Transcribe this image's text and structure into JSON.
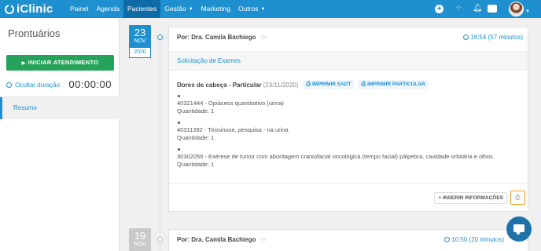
{
  "app": {
    "logo_text": "iClinic",
    "nav": [
      "Painel",
      "Agenda",
      "Pacientes",
      "Gestão",
      "Marketing",
      "Outros"
    ],
    "nav_active": "Pacientes",
    "top_icons": [
      "plus-circle-icon",
      "apps-grid-icon",
      "bell-icon",
      "chat-icon",
      "user-avatar"
    ]
  },
  "sidebar": {
    "title": "Prontuários",
    "start_button": "INICIAR ATENDIMENTO",
    "hide_duration": "Ocultar duração",
    "timer": "00:00:00",
    "items": [
      {
        "label": "Resumo",
        "active": true
      }
    ]
  },
  "timeline": {
    "entries": [
      {
        "day": "23",
        "month": "NOV",
        "year": "2020",
        "author": "Por: Dra. Camila Bachiego",
        "time": "16:54 (57 minutos)",
        "section_title": "Solicitação de Exames",
        "request_title": "Dores de cabeça - Particular",
        "request_date": "(23/11/2020)",
        "buttons": [
          "IMPRIMIR SADT",
          "IMPRIMIR PARTICULAR"
        ],
        "exams": [
          {
            "name": "40321444 - Opiáceos quantitativo (urina)",
            "qty": "Quantidade: 1"
          },
          {
            "name": "40311392 - Tirosinose, pesquisa - na urina",
            "qty": "Quantidade: 1"
          },
          {
            "name": "30302056 - Exérese de tumor com abordagem craniofacial oncológica (tempo facial) pálpebra, cavidade orbitária e olhos",
            "qty": "Quantidade: 1"
          }
        ],
        "insert_button": "INSERIR INFORMAÇÕES"
      },
      {
        "day": "19",
        "month": "NOV",
        "author": "Por: Dra. Camila Bachiego",
        "time": "10:50 (20 minutos)"
      }
    ]
  },
  "colors": {
    "primary": "#1e8fcf",
    "success": "#26a35a",
    "highlight": "#f39c1f"
  }
}
